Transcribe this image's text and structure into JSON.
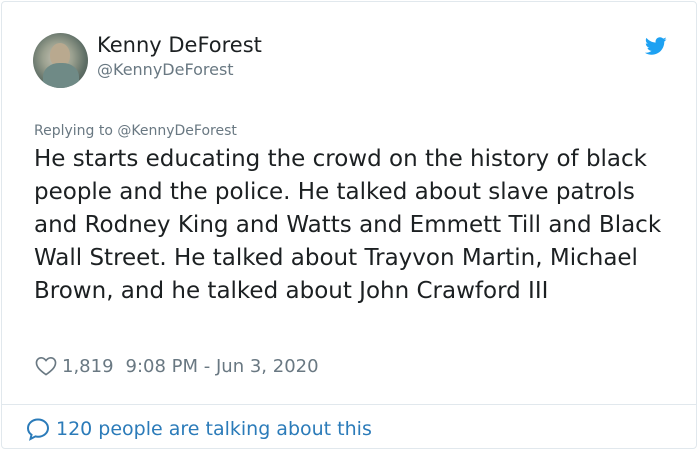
{
  "author": {
    "name": "Kenny DeForest",
    "handle": "@KennyDeForest"
  },
  "reply": {
    "prefix": "Replying to",
    "handle": "@KennyDeForest"
  },
  "tweet": {
    "text": "He starts educating the crowd on the history of black people and the police. He talked about slave patrols and Rodney King and Watts and Emmett Till and Black Wall Street. He talked about Trayvon Martin, Michael Brown, and he talked about John Crawford III"
  },
  "meta": {
    "likes": "1,819",
    "timestamp": "9:08 PM - Jun 3, 2020"
  },
  "footer": {
    "talking_label": "120 people are talking about this"
  },
  "icons": {
    "brand": "twitter-bird-icon",
    "like": "heart-icon",
    "discussion": "speech-bubble-icon"
  },
  "colors": {
    "brand": "#1da1f2",
    "link": "#2b7bb9",
    "muted": "#697882",
    "text": "#1c2022"
  }
}
